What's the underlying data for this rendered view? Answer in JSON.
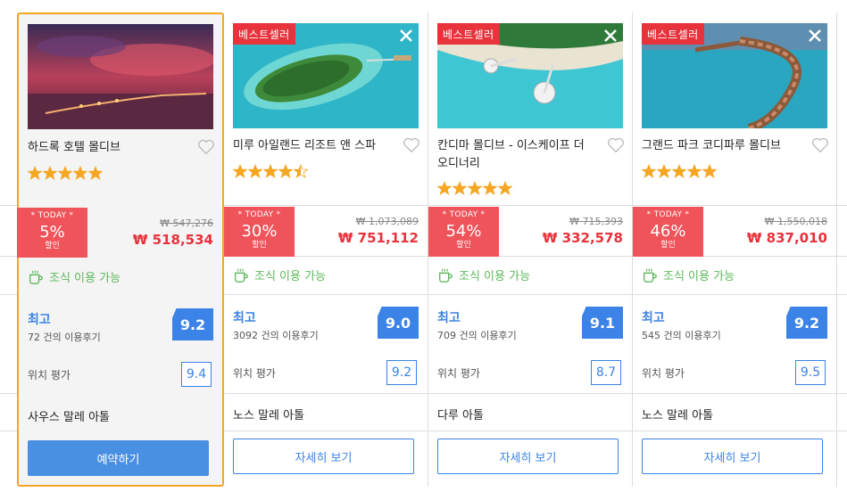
{
  "labels": {
    "today": "* TODAY *",
    "discount": "할인",
    "breakfast": "조식 이용 가능",
    "location_rating": "위치 평가"
  },
  "hotels": [
    {
      "name": "하드록 호텔 몰디브",
      "badge": "",
      "stars": 5,
      "discount_pct": "5%",
      "old_price": "₩ 547,276",
      "new_price": "₩ 518,534",
      "rating_word": "최고",
      "reviews": "72 건의 이용후기",
      "score": "9.2",
      "location_score": "9.4",
      "area": "사우스 말레 아톨",
      "button": "예약하기"
    },
    {
      "name": "미루 아일랜드 리조트 앤 스파",
      "badge": "베스트셀러",
      "stars": 4.5,
      "discount_pct": "30%",
      "old_price": "₩ 1,073,089",
      "new_price": "₩ 751,112",
      "rating_word": "최고",
      "reviews": "3092 건의 이용후기",
      "score": "9.0",
      "location_score": "9.2",
      "area": "노스 말레 아톨",
      "button": "자세히 보기"
    },
    {
      "name": "칸디마 몰디브 - 이스케이프 더 오디너리",
      "badge": "베스트셀러",
      "stars": 5,
      "discount_pct": "54%",
      "old_price": "₩ 715,393",
      "new_price": "₩ 332,578",
      "rating_word": "최고",
      "reviews": "709 건의 이용후기",
      "score": "9.1",
      "location_score": "8.7",
      "area": "다루 아톨",
      "button": "자세히 보기"
    },
    {
      "name": "그랜드 파크 코디파루 몰디브",
      "badge": "베스트셀러",
      "stars": 5,
      "discount_pct": "46%",
      "old_price": "₩ 1,550,018",
      "new_price": "₩ 837,010",
      "rating_word": "최고",
      "reviews": "545 건의 이용후기",
      "score": "9.2",
      "location_score": "9.5",
      "area": "노스 말레 아톨",
      "button": "자세히 보기"
    }
  ]
}
